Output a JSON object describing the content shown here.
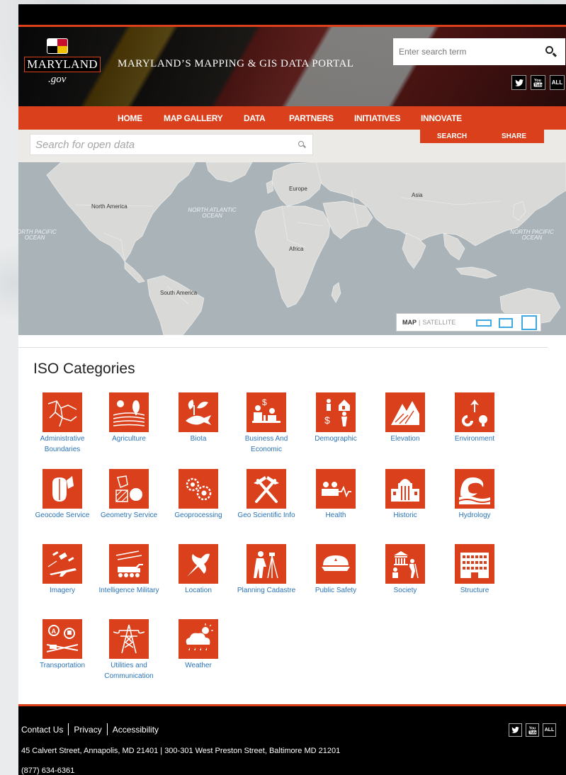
{
  "header": {
    "logo_text": "MARYLAND",
    "logo_sub": ".gov",
    "portal_title": "MARYLAND’S MAPPING & GIS DATA PORTAL",
    "search_placeholder": "Enter search term",
    "social": [
      "twitter-icon",
      "youtube-icon",
      "ALL"
    ],
    "social_all_label": "ALL",
    "youtube_label": "You Tube"
  },
  "nav": {
    "items": [
      "HOME",
      "MAP GALLERY",
      "DATA",
      "PARTNERS",
      "INITIATIVES",
      "INNOVATE"
    ]
  },
  "map_panel": {
    "search_placeholder": "Search for open data",
    "search_tab": "SEARCH",
    "share_tab": "SHARE",
    "labels": {
      "north_america": "North America",
      "europe": "Europe",
      "asia": "Asia",
      "africa": "Africa",
      "south_america": "South America",
      "north_atlantic": "NORTH ATLANTIC OCEAN",
      "north_pacific_left": "NORTH PACIFIC OCEAN",
      "north_pacific_right": "NORTH PACIFIC OCEAN"
    },
    "toggle_map": "MAP",
    "toggle_sep": "|",
    "toggle_satellite": "SATELLITE"
  },
  "iso": {
    "title": "ISO Categories",
    "categories": [
      {
        "label": "Administrative Boundaries",
        "icon": "administrative-boundaries-icon"
      },
      {
        "label": "Agriculture",
        "icon": "agriculture-icon"
      },
      {
        "label": "Biota",
        "icon": "biota-icon"
      },
      {
        "label": "Business And Economic",
        "icon": "business-icon"
      },
      {
        "label": "Demographic",
        "icon": "demographic-icon"
      },
      {
        "label": "Elevation",
        "icon": "elevation-icon"
      },
      {
        "label": "Environment",
        "icon": "environment-icon"
      },
      {
        "label": "Geocode Service",
        "icon": "geocode-icon"
      },
      {
        "label": "Geometry Service",
        "icon": "geometry-icon"
      },
      {
        "label": "Geoprocessing",
        "icon": "geoprocessing-icon"
      },
      {
        "label": "Geo Scientific Info",
        "icon": "geoscientific-icon"
      },
      {
        "label": "Health",
        "icon": "health-icon"
      },
      {
        "label": "Historic",
        "icon": "historic-icon"
      },
      {
        "label": "Hydrology",
        "icon": "hydrology-icon"
      },
      {
        "label": "Imagery",
        "icon": "imagery-icon"
      },
      {
        "label": "Intelligence Military",
        "icon": "military-icon"
      },
      {
        "label": "Location",
        "icon": "location-icon"
      },
      {
        "label": "Planning Cadastre",
        "icon": "planning-icon"
      },
      {
        "label": "Public Safety",
        "icon": "public-safety-icon"
      },
      {
        "label": "Society",
        "icon": "society-icon"
      },
      {
        "label": "Structure",
        "icon": "structure-icon"
      },
      {
        "label": "Transportation",
        "icon": "transportation-icon"
      },
      {
        "label": "Utilities and Communication",
        "icon": "utilities-icon"
      },
      {
        "label": "Weather",
        "icon": "weather-icon"
      }
    ]
  },
  "footer": {
    "links": [
      "Contact Us",
      "Privacy",
      "Accessibility"
    ],
    "address": "45 Calvert Street, Annapolis, MD 21401 | 300-301 West Preston Street, Baltimore MD 21201",
    "phone": "(877) 634-6361",
    "social_all_label": "ALL",
    "youtube_label": "You Tube"
  },
  "colors": {
    "accent": "#d9401b",
    "link": "#2a74b8",
    "map_water": "#aab3b8",
    "map_land": "#d9d9d7"
  }
}
